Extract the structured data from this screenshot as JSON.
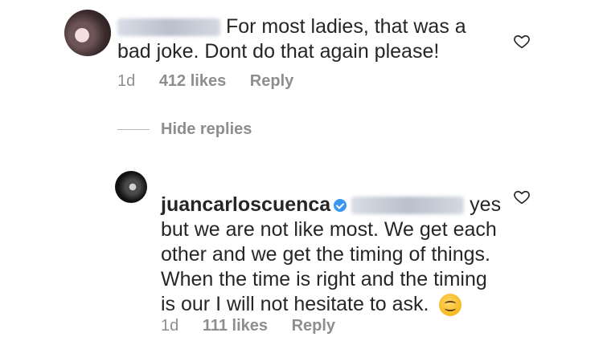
{
  "comments": [
    {
      "username_blurred": true,
      "text": "For most ladies, that was a bad joke. Dont do that again please!",
      "time": "1d",
      "likes": "412 likes",
      "reply": "Reply"
    },
    {
      "username": "juancarloscuenca",
      "verified": true,
      "mention_blurred": true,
      "text": "yes but we are not like most. We get each other and we get the timing of things. When the time is right and the timing is our I will not hesitate to ask.",
      "emoji": "smiling-face-emoji",
      "time": "1d",
      "likes": "111 likes",
      "reply": "Reply"
    }
  ],
  "hide_replies": "Hide replies",
  "icons": {
    "like": "heart-outline-icon",
    "verified": "verified-badge-icon"
  },
  "colors": {
    "text": "#262626",
    "meta": "#8e8e8e",
    "verified": "#3897f0"
  }
}
